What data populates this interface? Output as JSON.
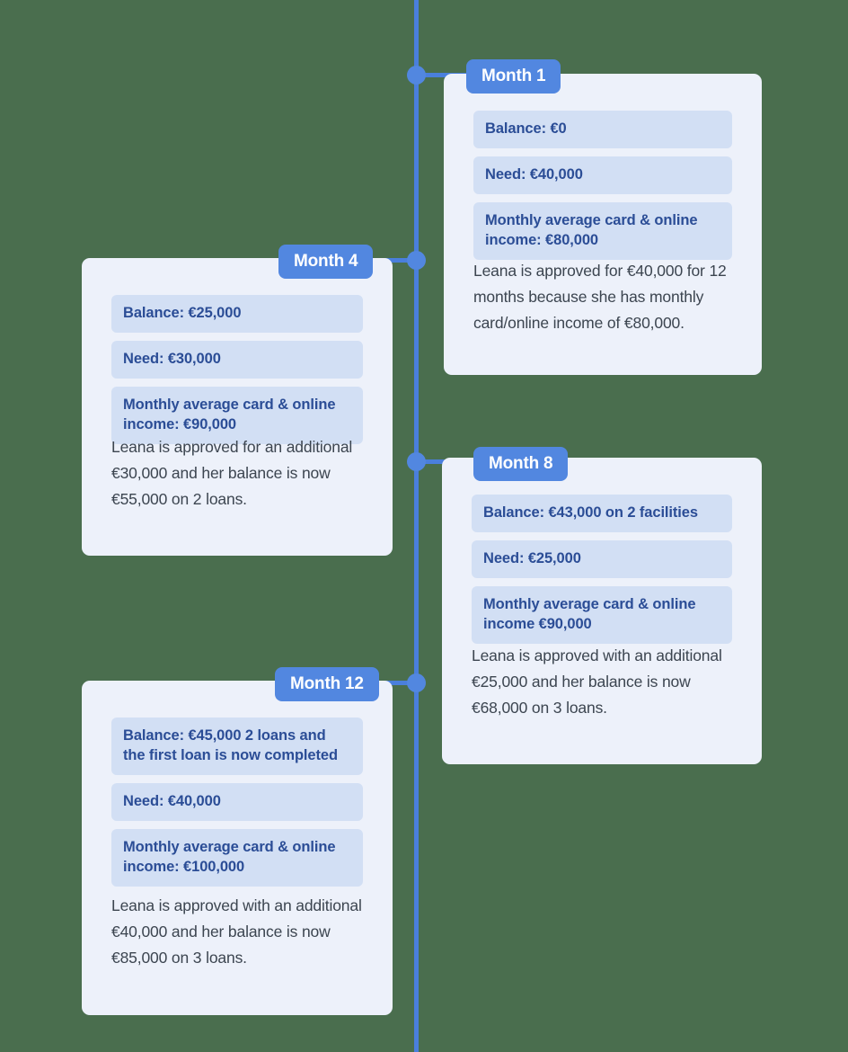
{
  "theme": {
    "page_background": "#4a6e4e",
    "timeline_line": "#4a7fdc",
    "node_fill": "#5287e0",
    "card_background": "#edf1fa",
    "row_background": "#d2dff4",
    "row_text": "#2b4d96",
    "body_text": "#3c4550",
    "pill_background": "#5287e0",
    "pill_text": "#ffffff"
  },
  "timeline": {
    "milestones": [
      {
        "id": "month-1",
        "label": "Month 1",
        "side": "right",
        "rows": [
          "Balance: €0",
          "Need: €40,000",
          "Monthly average card & online income: €80,000"
        ],
        "description": "Leana is approved for €40,000 for 12 months because she has monthly card/online income of €80,000."
      },
      {
        "id": "month-4",
        "label": "Month 4",
        "side": "left",
        "rows": [
          "Balance: €25,000",
          "Need: €30,000",
          "Monthly average card & online income: €90,000"
        ],
        "description": "Leana is approved for an additional €30,000 and her balance is now €55,000 on 2 loans."
      },
      {
        "id": "month-8",
        "label": "Month 8",
        "side": "right",
        "rows": [
          "Balance: €43,000 on 2 facilities",
          "Need: €25,000",
          "Monthly average card & online income €90,000"
        ],
        "description": "Leana is approved with an additional €25,000 and her balance is now €68,000 on 3 loans."
      },
      {
        "id": "month-12",
        "label": "Month 12",
        "side": "left",
        "rows": [
          "Balance: €45,000 2 loans and the first loan is now completed",
          "Need: €40,000",
          "Monthly average card & online income: €100,000"
        ],
        "description": "Leana is approved with an additional €40,000 and her balance is now €85,000 on 3 loans."
      }
    ]
  }
}
